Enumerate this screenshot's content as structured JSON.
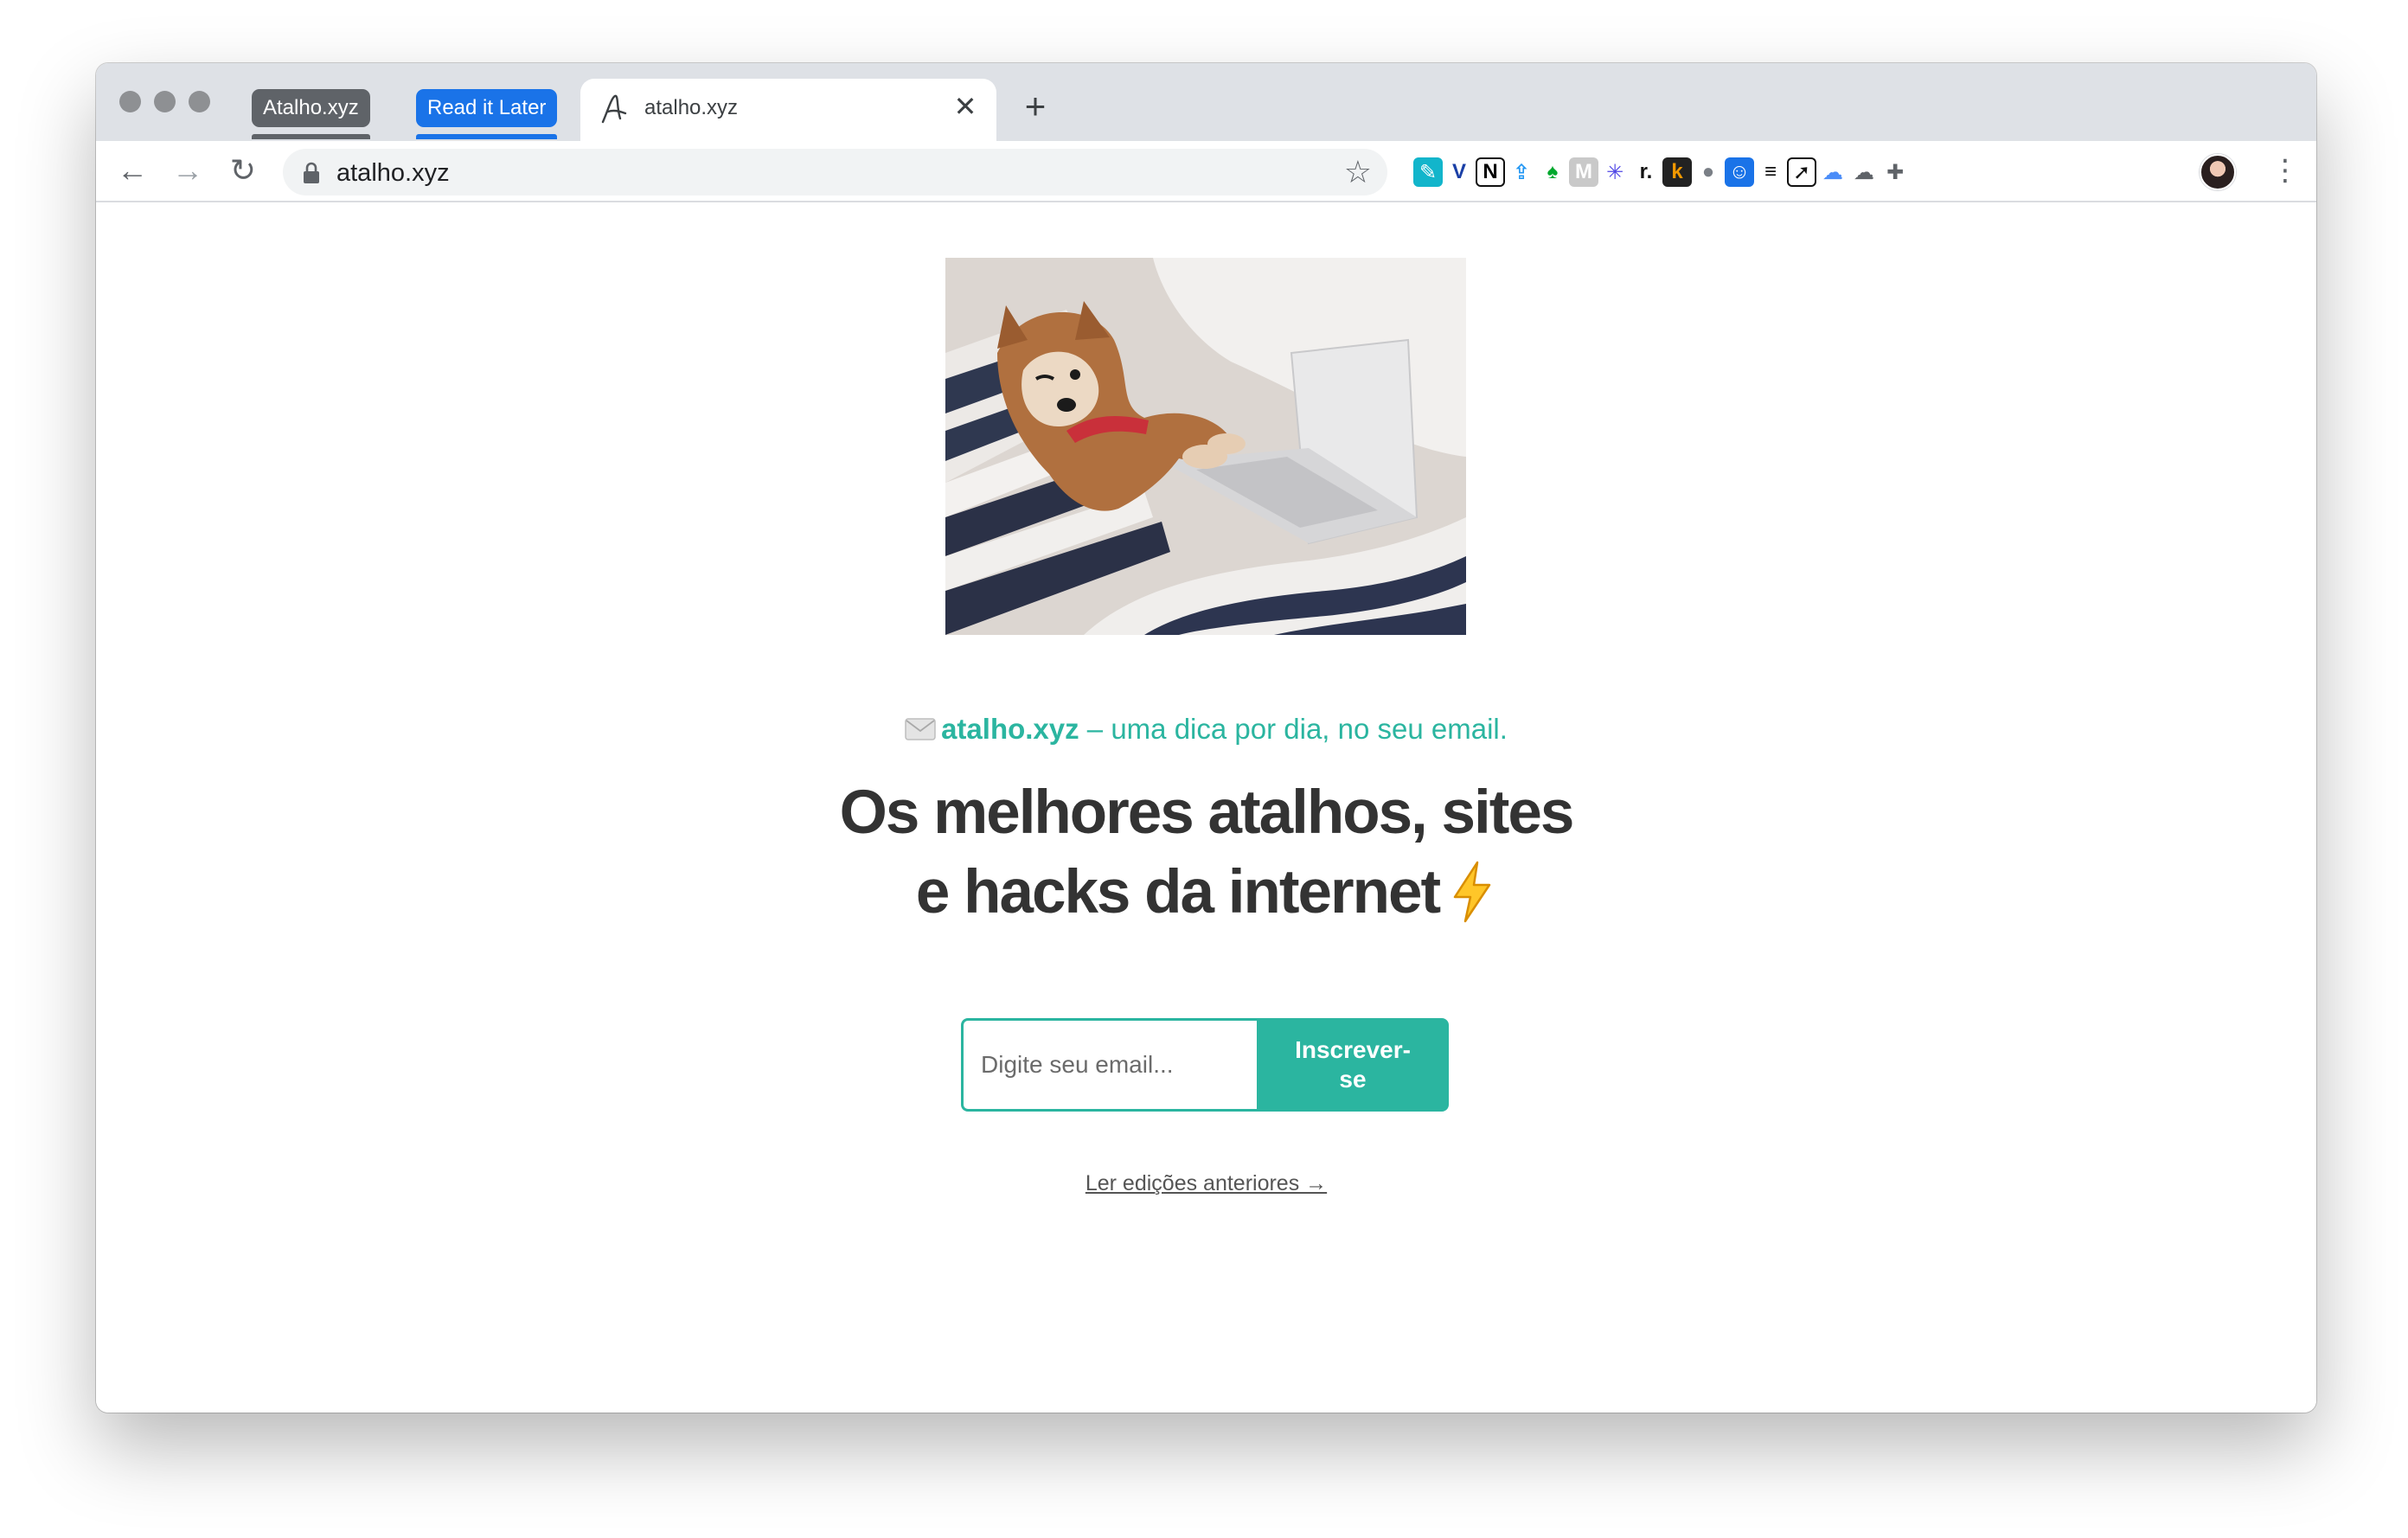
{
  "browser": {
    "tab_groups": [
      {
        "label": "Atalho.xyz",
        "color": "#5f6368"
      },
      {
        "label": "Read it Later",
        "color": "#1a73e8"
      }
    ],
    "active_tab": {
      "title": "atalho.xyz",
      "close_glyph": "✕"
    },
    "new_tab_glyph": "+",
    "nav": {
      "back": "←",
      "forward": "→",
      "reload": "↻"
    },
    "address_bar": {
      "url": "atalho.xyz",
      "bookmark_glyph": "☆"
    },
    "extensions": [
      {
        "name": "pen-extension-icon",
        "glyph": "✎",
        "color": "#ffffff",
        "bg": "#12b5cb"
      },
      {
        "name": "v-extension-icon",
        "glyph": "V",
        "color": "#1a3fa6",
        "bg": "transparent"
      },
      {
        "name": "notion-extension-icon",
        "glyph": "N",
        "color": "#000000",
        "bg": "#ffffff"
      },
      {
        "name": "share-extension-icon",
        "glyph": "⇪",
        "color": "#2196f3",
        "bg": "transparent"
      },
      {
        "name": "evernote-extension-icon",
        "glyph": "♠",
        "color": "#00a82d",
        "bg": "transparent"
      },
      {
        "name": "m-extension-icon",
        "glyph": "M",
        "color": "#ffffff",
        "bg": "#c9c9c9"
      },
      {
        "name": "asterisk-extension-icon",
        "glyph": "✳",
        "color": "#4f46e5",
        "bg": "transparent"
      },
      {
        "name": "readwise-extension-icon",
        "glyph": "r.",
        "color": "#111111",
        "bg": "transparent"
      },
      {
        "name": "k-extension-icon",
        "glyph": "k",
        "color": "#f29900",
        "bg": "#222222"
      },
      {
        "name": "record-extension-icon",
        "glyph": "●",
        "color": "#7a7f86",
        "bg": "transparent"
      },
      {
        "name": "bot-extension-icon",
        "glyph": "☺",
        "color": "#ffffff",
        "bg": "#1a73e8"
      },
      {
        "name": "list-extension-icon",
        "glyph": "≡",
        "color": "#111111",
        "bg": "transparent"
      },
      {
        "name": "send-extension-icon",
        "glyph": "➚",
        "color": "#111111",
        "bg": "#ffffff"
      },
      {
        "name": "cloud-blue-extension-icon",
        "glyph": "☁",
        "color": "#4b8df8",
        "bg": "transparent"
      },
      {
        "name": "cloud-outline-extension-icon",
        "glyph": "☁",
        "color": "#5f6368",
        "bg": "transparent"
      },
      {
        "name": "puzzle-extension-icon",
        "glyph": "✚",
        "color": "#5f6368",
        "bg": "transparent"
      }
    ],
    "menu_glyph": "⋮"
  },
  "page": {
    "tagline_brand": "atalho.xyz",
    "tagline_rest": " – uma dica por dia, no seu email.",
    "headline_line1": "Os melhores atalhos, sites",
    "headline_line2": "e hacks da internet",
    "email_placeholder": "Digite seu email...",
    "subscribe_label": "Inscrever-se",
    "archive_link": "Ler edições anteriores →"
  },
  "colors": {
    "accent": "#2bb5a0",
    "headline": "#333333",
    "tab_strip": "#dee1e6"
  }
}
